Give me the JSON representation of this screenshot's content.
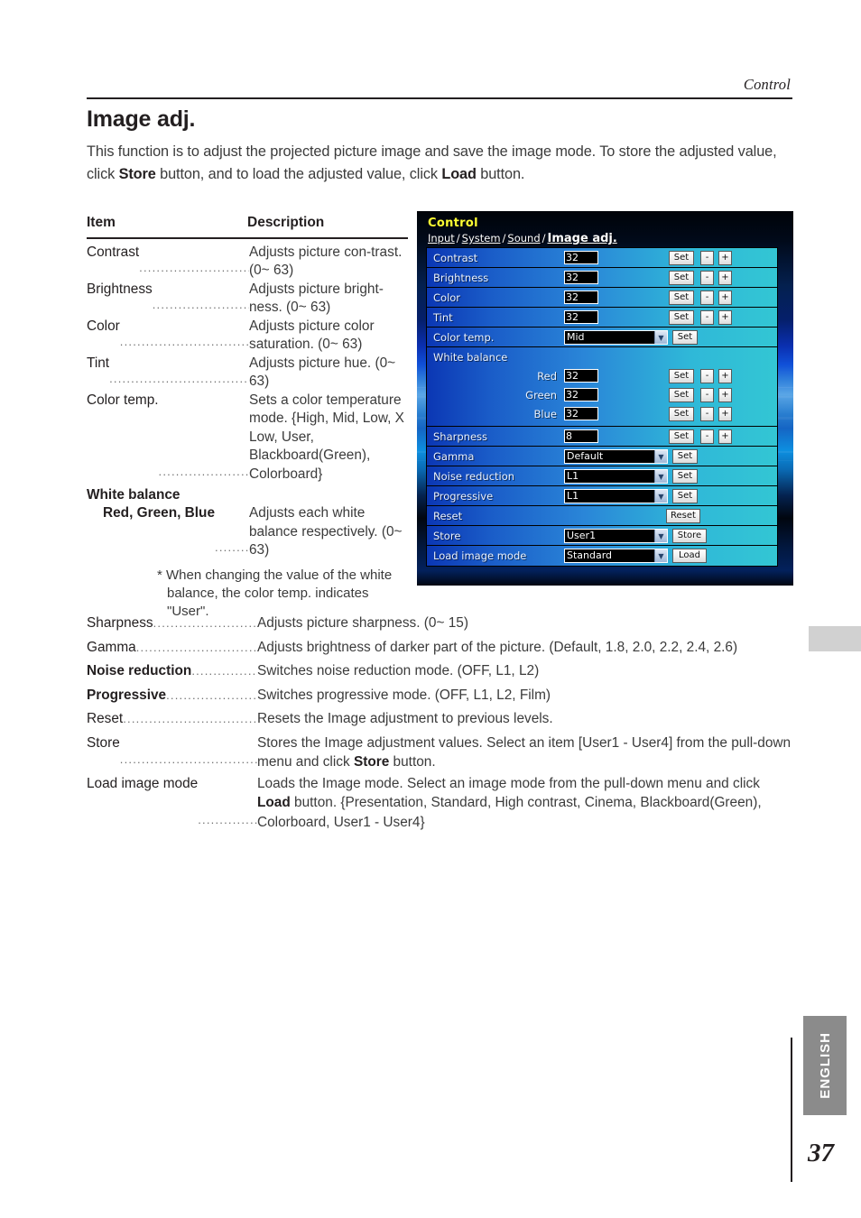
{
  "header": {
    "running_head": "Control"
  },
  "title": "Image adj.",
  "intro": {
    "part1": "This function is to adjust the projected picture image and save the image mode. To store the adjusted value, click ",
    "bold1": "Store",
    "part2": " button, and to load the adjusted value, click ",
    "bold2": "Load",
    "part3": " button."
  },
  "table": {
    "col_item": "Item",
    "col_description": "Description",
    "leader": "..................................................",
    "rows": [
      {
        "term": "Contrast",
        "desc": "Adjusts picture con-trast. (0~ 63)"
      },
      {
        "term": "Brightness",
        "desc": "Adjusts picture bright-ness. (0~ 63)"
      },
      {
        "term": "Color",
        "desc": "Adjusts picture color saturation. (0~ 63)"
      },
      {
        "term": "Tint",
        "desc": "Adjusts picture hue. (0~ 63)"
      },
      {
        "term": "Color temp.",
        "desc": "Sets a color temperature mode. {High, Mid, Low, X Low, User, Blackboard(Green), Colorboard}"
      }
    ],
    "white_balance_heading": "White balance",
    "white_balance_row": {
      "term": "Red, Green, Blue",
      "desc": "Adjusts each white balance respectively. (0~ 63)"
    },
    "white_balance_note": "* When changing the value of the white balance, the color temp. indicates \"User\"."
  },
  "list": [
    {
      "term": "Sharpness",
      "bold": false,
      "desc_pre": "Adjusts picture sharpness. (0~ 15)",
      "desc_bold": "",
      "desc_post": ""
    },
    {
      "term": "Gamma",
      "bold": false,
      "desc_pre": "Adjusts brightness of darker part of the picture. (Default, 1.8, 2.0, 2.2, 2.4, 2.6)",
      "desc_bold": "",
      "desc_post": ""
    },
    {
      "term": "Noise reduction",
      "bold": true,
      "desc_pre": "Switches noise reduction mode. (OFF, L1, L2)",
      "desc_bold": "",
      "desc_post": ""
    },
    {
      "term": "Progressive",
      "bold": true,
      "desc_pre": "Switches progressive mode. (OFF, L1, L2, Film)",
      "desc_bold": "",
      "desc_post": ""
    },
    {
      "term": "Reset",
      "bold": false,
      "desc_pre": "Resets the Image adjustment to previous levels.",
      "desc_bold": "",
      "desc_post": ""
    },
    {
      "term": "Store",
      "bold": false,
      "desc_pre": "Stores the Image adjustment values. Select an item [User1 - User4] from the pull-down menu and click ",
      "desc_bold": "Store",
      "desc_post": " button."
    },
    {
      "term": "Load image mode",
      "bold": false,
      "desc_pre": "Loads the Image mode. Select an image mode from the pull-down menu and click ",
      "desc_bold": "Load",
      "desc_post": " button. {Presentation, Standard, High contrast, Cinema, Blackboard(Green), Colorboard, User1 - User4}"
    }
  ],
  "screenshot": {
    "app_title": "Control",
    "nav": {
      "input": "Input",
      "system": "System",
      "sound": "Sound",
      "current": "Image adj.",
      "separator": "/"
    },
    "buttons": {
      "set": "Set",
      "minus": "-",
      "plus": "+",
      "reset": "Reset",
      "store": "Store",
      "load": "Load"
    },
    "arrow_glyph": "▼",
    "rows": [
      {
        "label": "Contrast",
        "value": "32"
      },
      {
        "label": "Brightness",
        "value": "32"
      },
      {
        "label": "Color",
        "value": "32"
      },
      {
        "label": "Tint",
        "value": "32"
      },
      {
        "label": "Color temp.",
        "value": "Mid"
      },
      {
        "label": "White balance",
        "value": ""
      },
      {
        "label": "Red",
        "value": "32"
      },
      {
        "label": "Green",
        "value": "32"
      },
      {
        "label": "Blue",
        "value": "32"
      },
      {
        "label": "Sharpness",
        "value": "8"
      },
      {
        "label": "Gamma",
        "value": "Default"
      },
      {
        "label": "Noise reduction",
        "value": "L1"
      },
      {
        "label": "Progressive",
        "value": "L1"
      },
      {
        "label": "Reset",
        "value": ""
      },
      {
        "label": "Store",
        "value": "User1"
      },
      {
        "label": "Load image mode",
        "value": "Standard"
      }
    ]
  },
  "footer": {
    "language_tab": "ENGLISH",
    "page_number": "37"
  },
  "colors": {
    "title_yellow": "#ffff33",
    "row_gradient_start": "#0b37b4",
    "row_gradient_end": "#33c6d4",
    "tab_gray": "#8b8b8b",
    "edge_marker": "#d1d1d1"
  }
}
